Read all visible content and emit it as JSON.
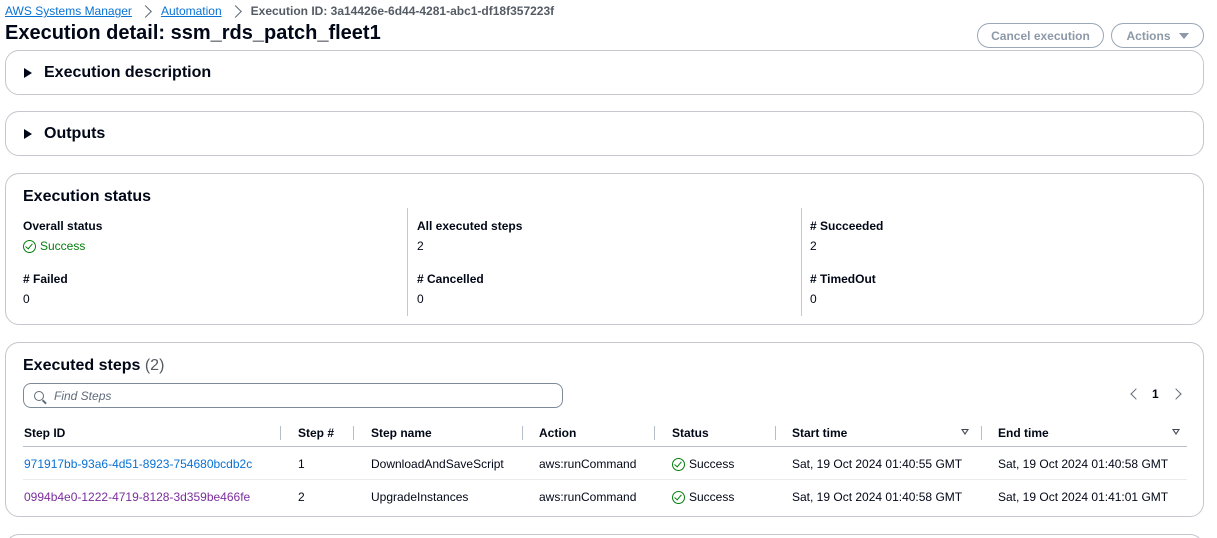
{
  "breadcrumb": {
    "items": [
      "AWS Systems Manager",
      "Automation"
    ],
    "current": "Execution ID: 3a14426e-6d44-4281-abc1-df18f357223f"
  },
  "page": {
    "title": "Execution detail: ssm_rds_patch_fleet1"
  },
  "header_actions": {
    "cancel_label": "Cancel execution",
    "actions_label": "Actions"
  },
  "execution_description": {
    "title": "Execution description"
  },
  "outputs": {
    "title": "Outputs"
  },
  "execution_status": {
    "title": "Execution status",
    "overall_status_label": "Overall status",
    "overall_status_value": "Success",
    "all_executed_steps_label": "All executed steps",
    "all_executed_steps_value": "2",
    "succeeded_label": "# Succeeded",
    "succeeded_value": "2",
    "failed_label": "# Failed",
    "failed_value": "0",
    "cancelled_label": "# Cancelled",
    "cancelled_value": "0",
    "timedout_label": "# TimedOut",
    "timedout_value": "0",
    "success_color": "#037f0c"
  },
  "executed_steps": {
    "title": "Executed steps",
    "count": "(2)",
    "search_placeholder": "Find Steps",
    "page_number": "1",
    "columns": [
      "Step ID",
      "Step #",
      "Step name",
      "Action",
      "Status",
      "Start time",
      "End time"
    ],
    "rows": [
      {
        "step_id": "971917bb-93a6-4d51-8923-754680bcdb2c",
        "step_num": "1",
        "step_name": "DownloadAndSaveScript",
        "action": "aws:runCommand",
        "status": "Success",
        "start_time": "Sat, 19 Oct 2024 01:40:55 GMT",
        "end_time": "Sat, 19 Oct 2024 01:40:58 GMT"
      },
      {
        "step_id": "0994b4e0-1222-4719-8128-3d359be466fe",
        "step_num": "2",
        "step_name": "UpgradeInstances",
        "action": "aws:runCommand",
        "status": "Success",
        "start_time": "Sat, 19 Oct 2024 01:40:58 GMT",
        "end_time": "Sat, 19 Oct 2024 01:41:01 GMT"
      }
    ]
  },
  "colors": {
    "link": "#0972d3",
    "visited_link": "#7b2d9c",
    "heading": "#000716",
    "border": "#c6c6cd"
  }
}
